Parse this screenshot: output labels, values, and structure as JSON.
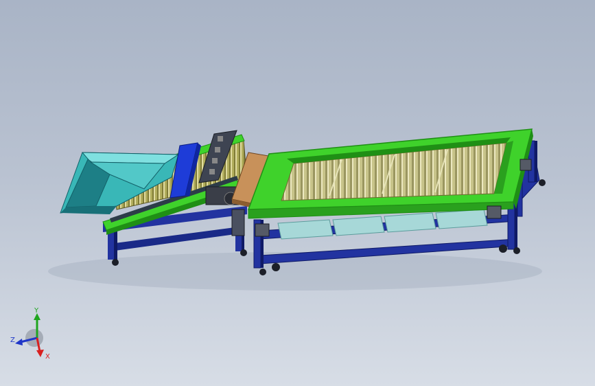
{
  "viewport": {
    "background_top": "#a9b4c6",
    "background_bottom": "#d7dde6"
  },
  "colors": {
    "frame_blue": "#2233a0",
    "frame_dark": "#0f1a66",
    "rail_green": "#3fd22b",
    "rail_green_dark": "#1f8f15",
    "hopper_teal": "#39b7b7",
    "hopper_teal_dark": "#1d7f86",
    "roller_olive": "#b4b05a",
    "chute_tan": "#c8915a",
    "paddle_blue": "#1e3cd8",
    "motor_gray": "#555a66",
    "glass": "#a7d8d8"
  },
  "triad": {
    "x_label": "X",
    "y_label": "Y",
    "z_label": "Z",
    "x_color": "#d81f1f",
    "y_color": "#1fa51f",
    "z_color": "#1f36c8"
  }
}
